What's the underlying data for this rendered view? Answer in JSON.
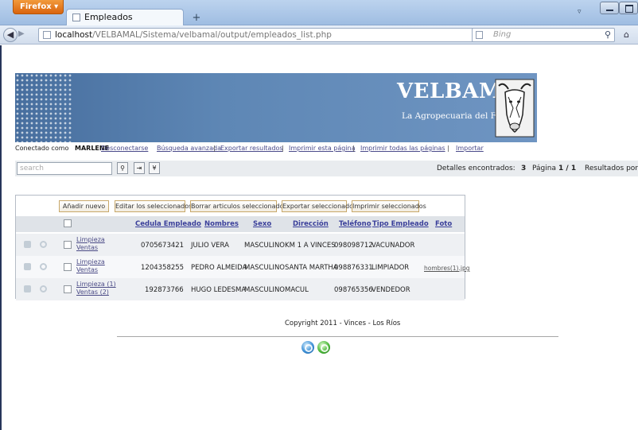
{
  "browser": {
    "app_button": "Firefox",
    "tab_title": "Empleados",
    "new_tab": "+",
    "url_host": "localhost",
    "url_path": "/VELBAMAL/Sistema/velbamal/output/empleados_list.php",
    "search_engine": "Bing"
  },
  "banner": {
    "title": "VELBAMAL",
    "subtitle": "La Agropecuaria del Futuro."
  },
  "connection": {
    "connected_as": "Conectado como",
    "user": "MARLENE",
    "logout": "Desconectarse",
    "links": [
      "Búsqueda avanzada",
      "Exportar resultados",
      "Imprimir esta página",
      "Imprimir todas las páginas",
      "Importar"
    ],
    "separator": "|"
  },
  "toolbar": {
    "search_placeholder": "search",
    "details_label": "Detalles encontrados:",
    "details_count": "3",
    "page_label": "Página",
    "page_value": "1 / 1",
    "rpp_label": "Resultados por página:"
  },
  "grid": {
    "actions": [
      "Añadir nuevo",
      "Editar los seleccionados",
      "Borrar articulos seleccionados",
      "Exportar seleccionados",
      "Imprimir seleccionados"
    ],
    "columns": [
      "Cedula Empleado",
      "Nombres",
      "Sexo",
      "Dirección",
      "Teléfono",
      "Tipo Empleado",
      "Foto"
    ],
    "rows": [
      {
        "link1": "Limpieza",
        "link2": "Ventas",
        "cedula": "0705673421",
        "nombres": "JULIO VERA",
        "sexo": "MASCULINO",
        "direccion": "KM 1 A VINCES",
        "telefono": "098098712",
        "tipo": "VACUNADOR",
        "foto": ""
      },
      {
        "link1": "Limpieza",
        "link2": "Ventas",
        "cedula": "1204358255",
        "nombres": "PEDRO ALMEIDA",
        "sexo": "MASCULINO",
        "direccion": "SANTA MARTHA",
        "telefono": "098876331",
        "tipo": "LIMPIADOR",
        "foto": "hombres(1).jpg"
      },
      {
        "link1": "Limpieza (1)",
        "link2": "Ventas (2)",
        "cedula": "192873766",
        "nombres": "HUGO LEDESMA",
        "sexo": "MASCULINO",
        "direccion": "MACUL",
        "telefono": "098765356",
        "tipo": "VENDEDOR",
        "foto": ""
      }
    ]
  },
  "footer": {
    "copyright": "Copyright 2011 - Vinces - Los Ríos"
  },
  "colors": {
    "banner": "#5e87b5",
    "link": "#3a3f9a",
    "chrome": "#bcd3ee"
  }
}
